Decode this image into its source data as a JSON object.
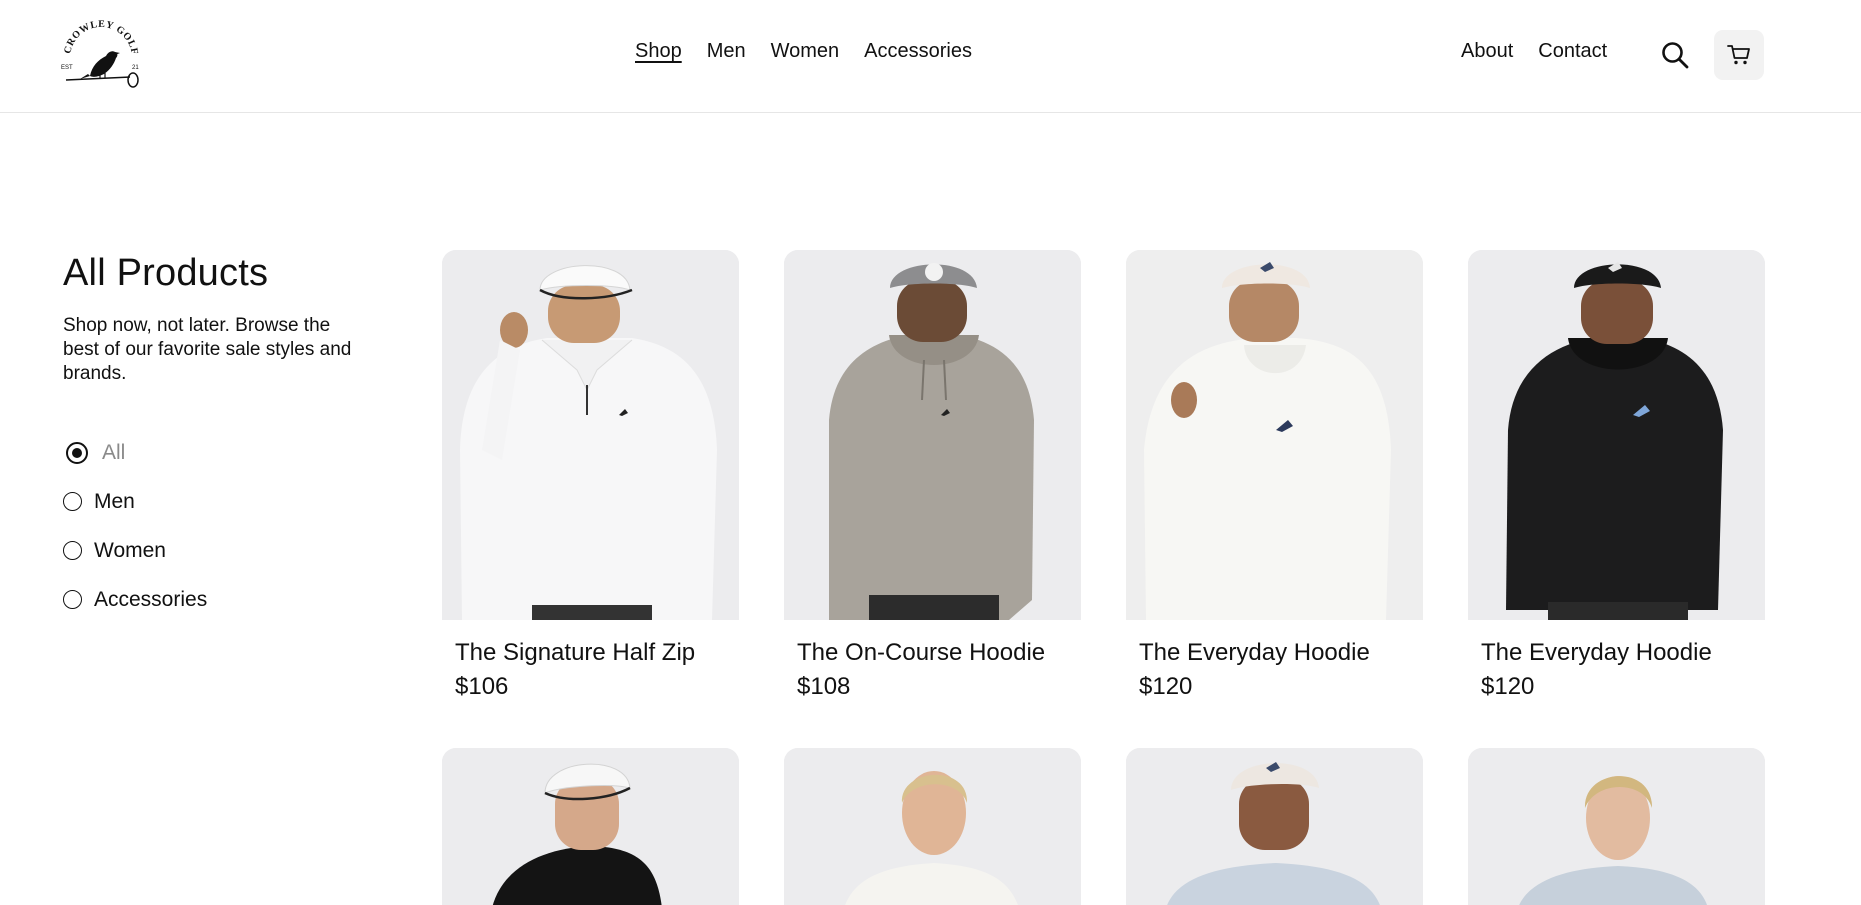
{
  "brand": {
    "logo_text": "CROWLEY GOLF CO.",
    "est_left": "EST",
    "est_right": "21"
  },
  "nav": {
    "center": [
      {
        "label": "Shop",
        "active": true
      },
      {
        "label": "Men"
      },
      {
        "label": "Women"
      },
      {
        "label": "Accessories"
      }
    ],
    "right": [
      {
        "label": "About"
      },
      {
        "label": "Contact"
      }
    ],
    "search_icon": "search-icon",
    "cart_icon": "cart-icon"
  },
  "sidebar": {
    "title": "All Products",
    "description": "Shop now, not later. Browse the best of our favorite sale styles and brands.",
    "filters": [
      {
        "label": "All",
        "selected": true
      },
      {
        "label": "Men"
      },
      {
        "label": "Women"
      },
      {
        "label": "Accessories"
      }
    ]
  },
  "products": [
    {
      "name": "The Signature Half Zip",
      "price": "$106",
      "color": "#f4f4f5"
    },
    {
      "name": "The On-Course Hoodie",
      "price": "$108",
      "color": "#a8a39b"
    },
    {
      "name": "The Everyday Hoodie",
      "price": "$120",
      "color": "#f6f6f3"
    },
    {
      "name": "The Everyday Hoodie",
      "price": "$120",
      "color": "#1c1c1d"
    },
    {
      "color": "#141414"
    },
    {
      "color": "#f5f4f0"
    },
    {
      "color": "#c9d3df"
    },
    {
      "color": "#c6d0db"
    }
  ]
}
